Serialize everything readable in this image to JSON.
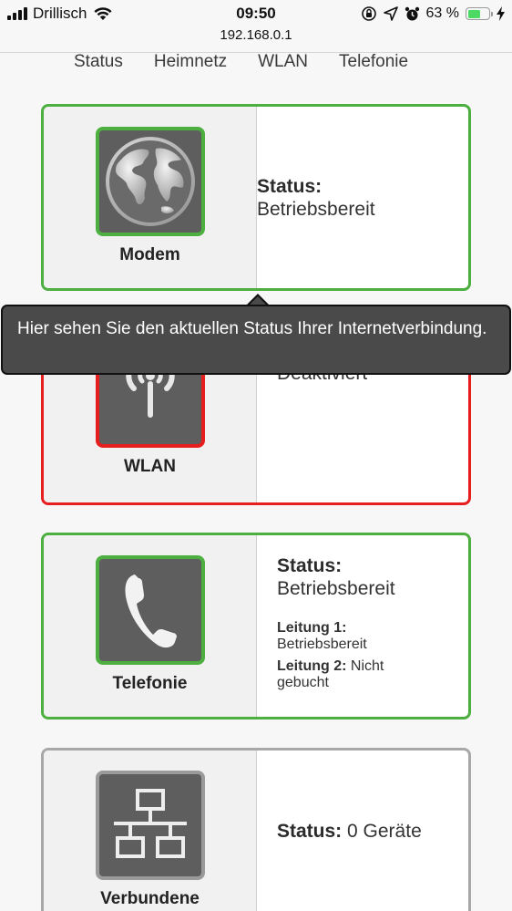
{
  "statusbar": {
    "carrier": "Drillisch",
    "time": "09:50",
    "battery": "63 %",
    "battery_level": 0.63,
    "icons": [
      "signal-icon",
      "wifi-icon",
      "rotation-lock-icon",
      "location-icon",
      "alarm-icon",
      "battery-icon",
      "charging-icon"
    ]
  },
  "url": "192.168.0.1",
  "nav": {
    "items": [
      "Status",
      "Heimnetz",
      "WLAN",
      "Telefonie"
    ]
  },
  "cards": {
    "modem": {
      "label": "Modem",
      "icon": "globe-icon",
      "status_title": "Status:",
      "status_value": "Betriebsbereit",
      "state_color": "#4caf3f"
    },
    "wlan": {
      "label": "WLAN",
      "icon": "antenna-icon",
      "status_value": "Deaktiviert",
      "state_color": "#e61e1e"
    },
    "telefonie": {
      "label": "Telefonie",
      "icon": "phone-handset-icon",
      "status_title": "Status:",
      "status_value": "Betriebsbereit",
      "line1_label": "Leitung 1:",
      "line1_value": "Betriebsbereit",
      "line2_label": "Leitung 2:",
      "line2_value": "Nicht gebucht",
      "state_color": "#4caf3f"
    },
    "devices": {
      "label": "Verbundene",
      "icon": "network-icon",
      "status_title": "Status:",
      "status_value": "0 Geräte",
      "state_color": "#a8a8a8"
    }
  },
  "tooltip": {
    "text": "Hier sehen Sie den aktuellen Status Ihrer Internetverbindung."
  }
}
